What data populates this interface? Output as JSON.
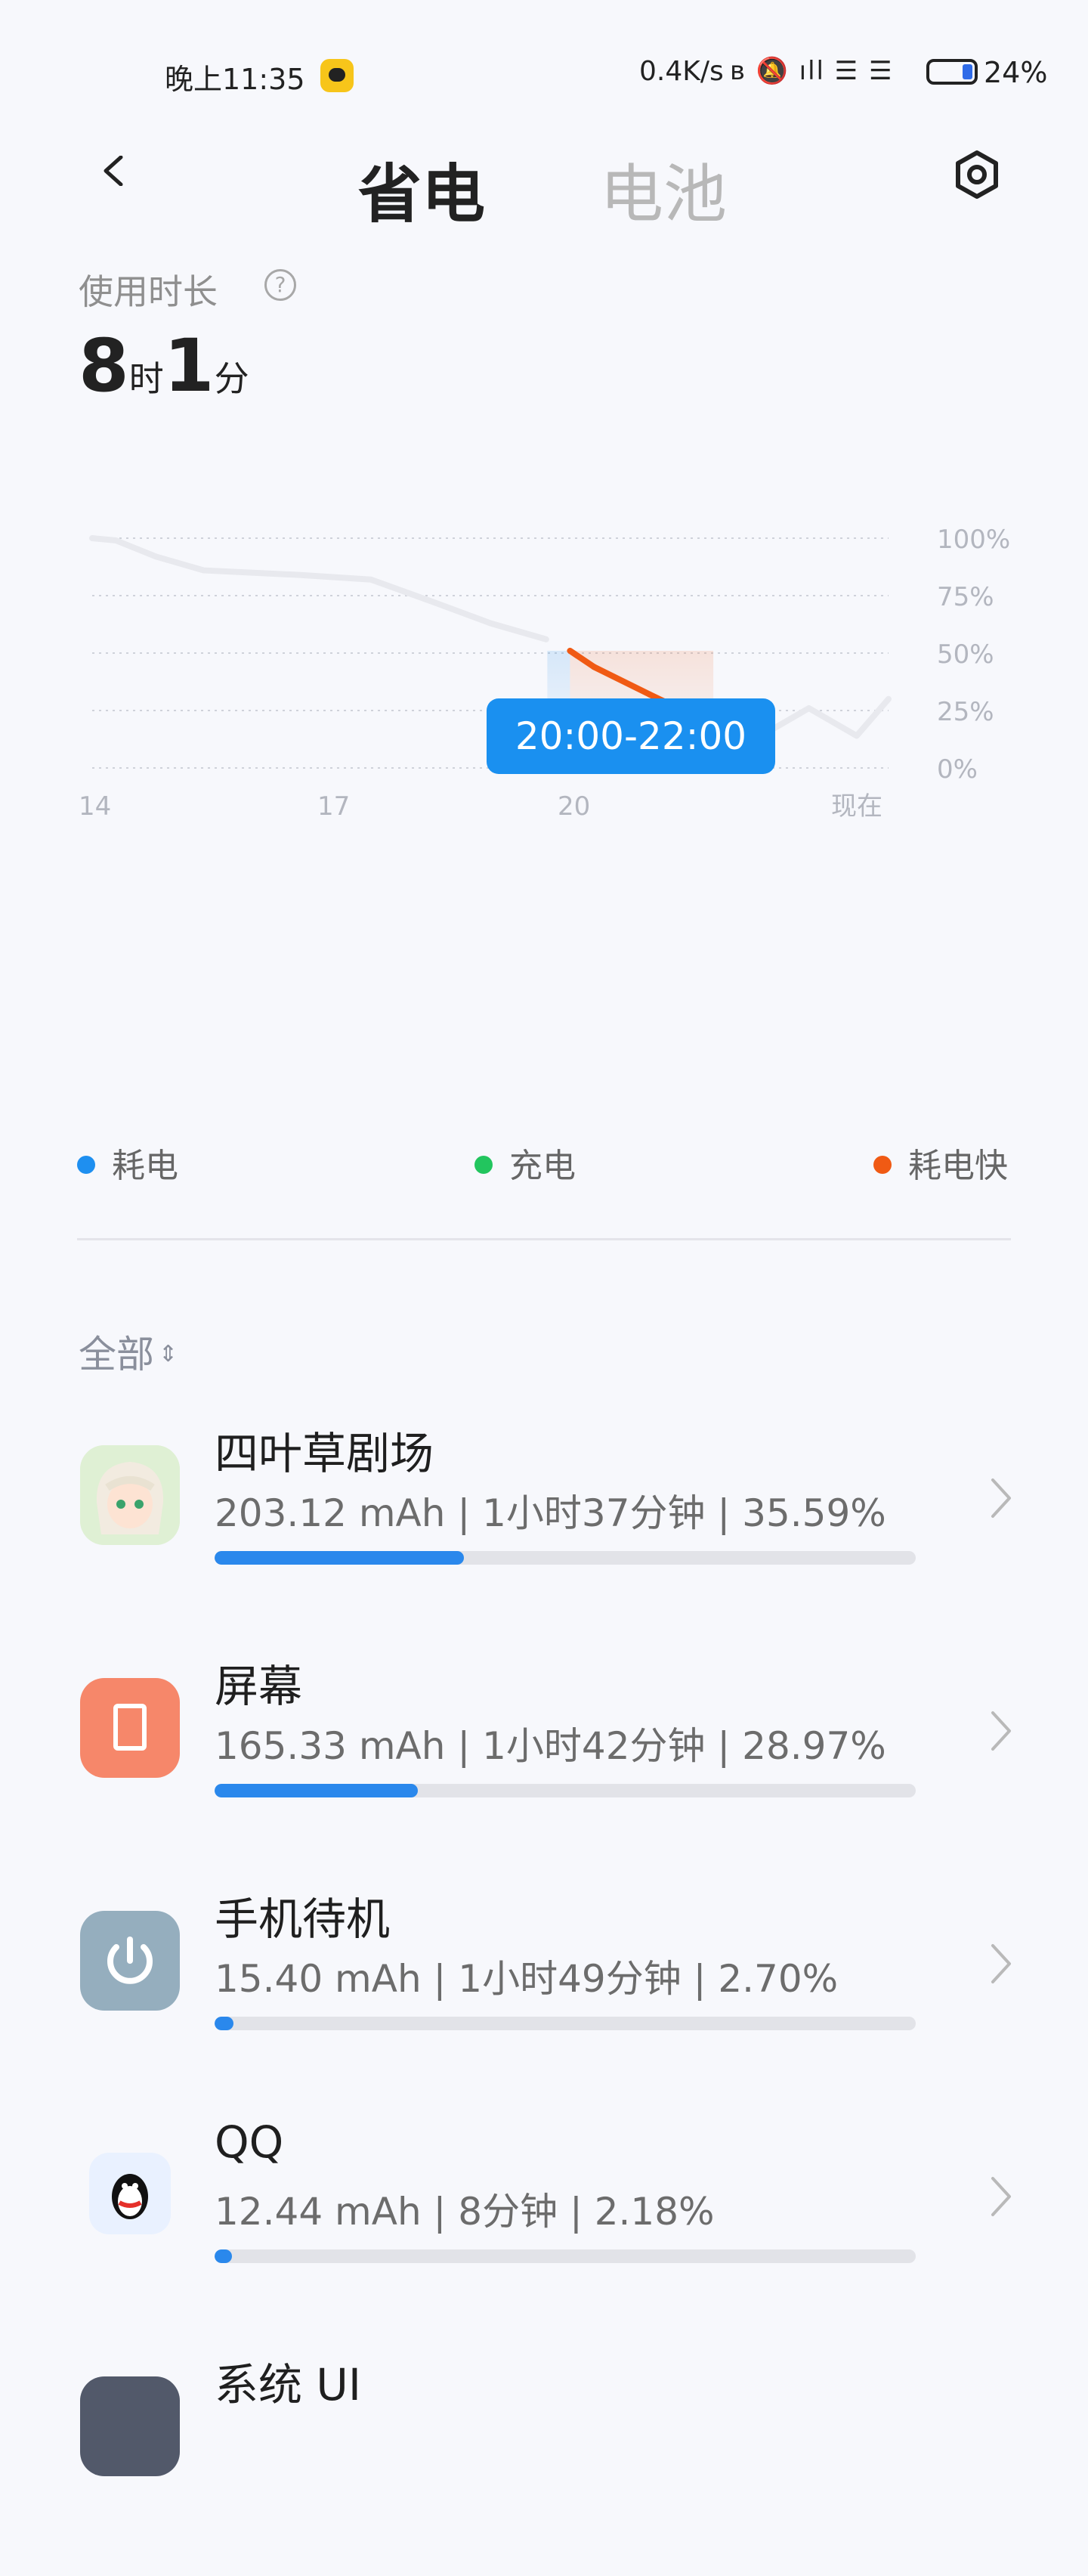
{
  "status_bar": {
    "time": "晚上11:35",
    "network_speed": "0.4K/s",
    "system_icons": "ʙ 🔕 ıll ☰ ☰",
    "battery_percent": "24%",
    "battery_level": 0.24
  },
  "header": {
    "tab_active": "省电",
    "tab_inactive": "电池"
  },
  "usage": {
    "label": "使用时长",
    "help": "?",
    "hours": "8",
    "hours_unit": "时",
    "minutes": "1",
    "minutes_unit": "分"
  },
  "chart_data": {
    "type": "line",
    "x_tick_labels": [
      "14",
      "17",
      "20",
      "现在"
    ],
    "y_tick_labels": [
      "100%",
      "75%",
      "50%",
      "25%",
      "0%"
    ],
    "ylim": [
      0,
      100
    ],
    "xlim": [
      14,
      24
    ],
    "grid": true,
    "tooltip": "20:00-22:00",
    "background_series": {
      "x": [
        14.0,
        14.3,
        14.8,
        15.4,
        16.6,
        17.5,
        18.3,
        19.0,
        19.7
      ],
      "y": [
        100,
        99,
        92,
        86,
        84,
        82,
        72,
        63,
        56
      ]
    },
    "highlight_series": {
      "x": [
        20.0,
        20.3,
        21.0,
        21.3,
        21.7,
        21.8
      ],
      "y": [
        51,
        44,
        32,
        27,
        21,
        15
      ],
      "segment_colors": [
        "#f05a14",
        "#f05a14",
        "#f05a14",
        "#2a90e8",
        "#f05a14"
      ]
    },
    "tail_series": {
      "x": [
        21.8,
        22.2,
        23.0,
        23.6,
        24.0
      ],
      "y": [
        15,
        10,
        26,
        14,
        30
      ]
    }
  },
  "legend": [
    {
      "label": "耗电",
      "color": "#1e8ff0"
    },
    {
      "label": "充电",
      "color": "#22c55e"
    },
    {
      "label": "耗电快",
      "color": "#f05a14"
    }
  ],
  "filter": {
    "label": "全部"
  },
  "apps": [
    {
      "name": "四叶草剧场",
      "stats": "203.12 mAh | 1小时37分钟 | 35.59%",
      "fraction": 0.3559,
      "icon": "game-avatar-icon",
      "color": "#dff0d4"
    },
    {
      "name": "屏幕",
      "stats": "165.33 mAh | 1小时42分钟 | 28.97%",
      "fraction": 0.2897,
      "icon": "screen-icon",
      "color": "#f6876a"
    },
    {
      "name": "手机待机",
      "stats": "15.40 mAh | 1小时49分钟 | 2.70%",
      "fraction": 0.027,
      "icon": "power-icon",
      "color": "#95aebe"
    },
    {
      "name": "QQ",
      "stats": "12.44 mAh | 8分钟 | 2.18%",
      "fraction": 0.0218,
      "icon": "qq-penguin-icon",
      "color": "#e9f1ff"
    },
    {
      "name": "系统 UI",
      "stats": "",
      "fraction": 0.0,
      "icon": "system-ui-icon",
      "color": "#52596a"
    }
  ]
}
